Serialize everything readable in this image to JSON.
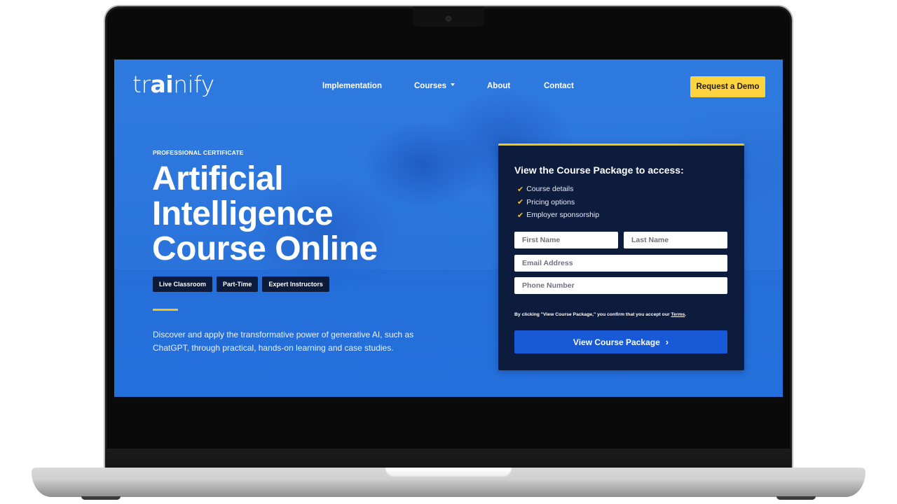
{
  "header": {
    "logo": {
      "pre": "tr",
      "bold": "ai",
      "post": "nify"
    },
    "nav": [
      {
        "label": "Implementation",
        "has_dropdown": false
      },
      {
        "label": "Courses",
        "has_dropdown": true
      },
      {
        "label": "About",
        "has_dropdown": false
      },
      {
        "label": "Contact",
        "has_dropdown": false
      }
    ],
    "cta_label": "Request a Demo"
  },
  "hero": {
    "eyebrow": "PROFESSIONAL CERTIFICATE",
    "title_lines": [
      "Artificial",
      "Intelligence",
      "Course Online"
    ],
    "tags": [
      "Live Classroom",
      "Part-Time",
      "Expert Instructors"
    ],
    "description": "Discover and apply the transformative power of generative AI, such as ChatGPT, through practical, hands-on learning and case studies."
  },
  "form": {
    "title": "View the Course Package to access:",
    "benefits": [
      "Course details",
      "Pricing options",
      "Employer sponsorship"
    ],
    "fields": {
      "first_name": {
        "placeholder": "First Name",
        "value": ""
      },
      "last_name": {
        "placeholder": "Last Name",
        "value": ""
      },
      "email": {
        "placeholder": "Email Address",
        "value": ""
      },
      "phone": {
        "placeholder": "Phone Number",
        "value": ""
      }
    },
    "disclaimer_prefix": "By clicking \"View Course Package,\" you confirm that you accept our ",
    "disclaimer_link": "Terms",
    "disclaimer_suffix": ".",
    "submit_label": "View Course Package"
  },
  "colors": {
    "hero_blue": "#2a74dc",
    "accent_yellow": "#fdd33f",
    "panel_navy": "#0d1b3d",
    "button_blue": "#1759d6"
  }
}
